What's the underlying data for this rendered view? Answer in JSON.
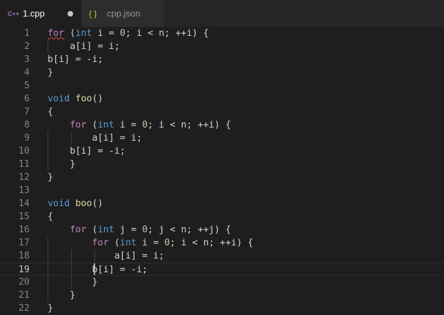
{
  "tabs": [
    {
      "label": "1.cpp",
      "icon": "cpp-file-icon",
      "active": true,
      "modified": true
    },
    {
      "label": "cpp.json",
      "icon": "json-file-icon",
      "active": false,
      "modified": false
    }
  ],
  "editor": {
    "current_line": 19,
    "colors": {
      "keyword": "#c586c0",
      "type": "#569cd6",
      "function": "#dcdcaa",
      "number": "#b5cea8",
      "text": "#d4d4d4"
    },
    "lines": [
      {
        "n": "1",
        "t": [
          [
            "kw",
            "for"
          ],
          [
            "p",
            " ("
          ],
          [
            "ty",
            "int"
          ],
          [
            "p",
            " i = "
          ],
          [
            "num",
            "0"
          ],
          [
            "p",
            "; i < n; ++i) {"
          ]
        ]
      },
      {
        "n": "2",
        "t": [
          [
            "p",
            "    a[i] = i;"
          ]
        ]
      },
      {
        "n": "3",
        "t": [
          [
            "p",
            "b[i] = -i;"
          ]
        ]
      },
      {
        "n": "4",
        "t": [
          [
            "p",
            "}"
          ]
        ]
      },
      {
        "n": "5",
        "t": []
      },
      {
        "n": "6",
        "t": [
          [
            "ty",
            "void"
          ],
          [
            "p",
            " "
          ],
          [
            "fn",
            "foo"
          ],
          [
            "p",
            "()"
          ]
        ]
      },
      {
        "n": "7",
        "t": [
          [
            "p",
            "{"
          ]
        ]
      },
      {
        "n": "8",
        "t": [
          [
            "p",
            "    "
          ],
          [
            "kw",
            "for"
          ],
          [
            "p",
            " ("
          ],
          [
            "ty",
            "int"
          ],
          [
            "p",
            " i = "
          ],
          [
            "num",
            "0"
          ],
          [
            "p",
            "; i < n; ++i) {"
          ]
        ]
      },
      {
        "n": "9",
        "t": [
          [
            "p",
            "        a[i] = i;"
          ]
        ]
      },
      {
        "n": "10",
        "t": [
          [
            "p",
            "    b[i] = -i;"
          ]
        ]
      },
      {
        "n": "11",
        "t": [
          [
            "p",
            "    }"
          ]
        ]
      },
      {
        "n": "12",
        "t": [
          [
            "p",
            "}"
          ]
        ]
      },
      {
        "n": "13",
        "t": []
      },
      {
        "n": "14",
        "t": [
          [
            "ty",
            "void"
          ],
          [
            "p",
            " "
          ],
          [
            "fn",
            "boo"
          ],
          [
            "p",
            "()"
          ]
        ]
      },
      {
        "n": "15",
        "t": [
          [
            "p",
            "{"
          ]
        ]
      },
      {
        "n": "16",
        "t": [
          [
            "p",
            "    "
          ],
          [
            "kw",
            "for"
          ],
          [
            "p",
            " ("
          ],
          [
            "ty",
            "int"
          ],
          [
            "p",
            " j = "
          ],
          [
            "num",
            "0"
          ],
          [
            "p",
            "; j < n; ++j) {"
          ]
        ]
      },
      {
        "n": "17",
        "t": [
          [
            "p",
            "        "
          ],
          [
            "kw",
            "for"
          ],
          [
            "p",
            " ("
          ],
          [
            "ty",
            "int"
          ],
          [
            "p",
            " i = "
          ],
          [
            "num",
            "0"
          ],
          [
            "p",
            "; i < n; ++i) {"
          ]
        ]
      },
      {
        "n": "18",
        "t": [
          [
            "p",
            "            a[i] = i;"
          ]
        ]
      },
      {
        "n": "19",
        "t": [
          [
            "p",
            "        b[i] = -i;"
          ]
        ]
      },
      {
        "n": "20",
        "t": [
          [
            "p",
            "        }"
          ]
        ]
      },
      {
        "n": "21",
        "t": [
          [
            "p",
            "    }"
          ]
        ]
      },
      {
        "n": "22",
        "t": [
          [
            "p",
            "}"
          ]
        ]
      }
    ]
  }
}
